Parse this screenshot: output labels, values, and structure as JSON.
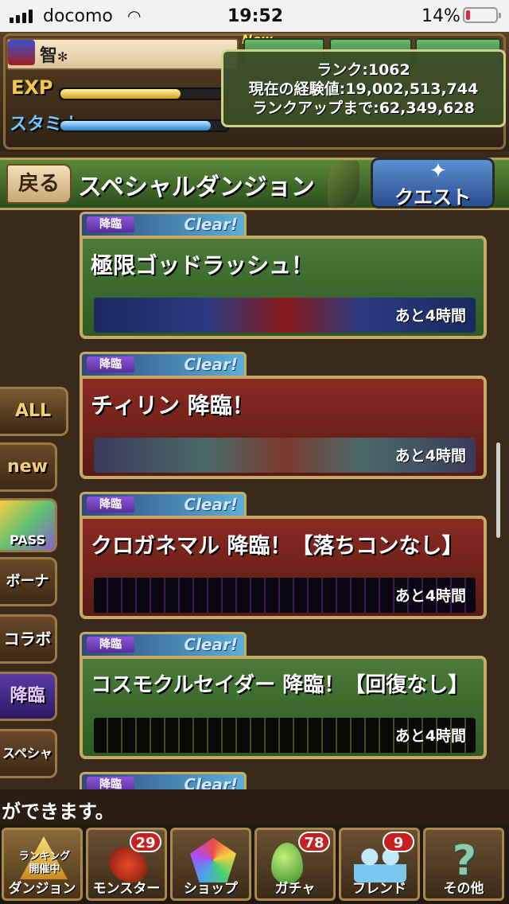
{
  "status_bar": {
    "carrier": "docomo",
    "time": "19:52",
    "battery": "14%",
    "battery_level": 0.14
  },
  "header": {
    "player_name": "智",
    "name_mark": "✻",
    "new_tag": "New",
    "exp_label": "EXP",
    "stamina_label": "スタミナ",
    "exp_fill": 0.72,
    "stamina_fill": 0.9,
    "rank": {
      "line1": "ランク:1062",
      "line2": "現在の経験値:19,002,513,744",
      "line3": "ランクアップまで:62,349,628"
    }
  },
  "titlebar": {
    "back_label": "戻る",
    "title": "スペシャルダンジョン",
    "quest_label": "クエスト"
  },
  "side_tabs": [
    {
      "label": "ALL",
      "color": "#f4d070"
    },
    {
      "label": "new",
      "color": "#f0d080"
    },
    {
      "label": "PASS",
      "color": "#ffffff"
    },
    {
      "label": "ボーナス",
      "color": "#ffffff"
    },
    {
      "label": "コラボ",
      "color": "#ffffff"
    },
    {
      "label": "降臨",
      "color": "#e8c8ff"
    },
    {
      "label": "スペシャル",
      "color": "#ffffff"
    }
  ],
  "dungeons": [
    {
      "badge": "降臨",
      "clear": "Clear!",
      "name": "極限ゴッドラッシュ！",
      "remaining": "あと4時間",
      "theme": "green"
    },
    {
      "badge": "降臨",
      "clear": "Clear!",
      "name": "チィリン 降臨！",
      "remaining": "あと4時間",
      "theme": "red"
    },
    {
      "badge": "降臨",
      "clear": "Clear!",
      "name": "クロガネマル 降臨！【落ちコンなし】",
      "remaining": "あと4時間",
      "theme": "red"
    },
    {
      "badge": "降臨",
      "clear": "Clear!",
      "name": "コスモクルセイダー 降臨！【回復なし】",
      "remaining": "あと4時間",
      "theme": "green"
    }
  ],
  "partial_card": {
    "badge": "降臨",
    "clear": "Clear!"
  },
  "message": "ができます。",
  "nav": [
    {
      "label": "ダンジョン",
      "sub": "ランキング\n開催中",
      "count": ""
    },
    {
      "label": "モンスター",
      "count": "29"
    },
    {
      "label": "ショップ",
      "count": ""
    },
    {
      "label": "ガチャ",
      "count": "78"
    },
    {
      "label": "フレンド",
      "count": "9"
    },
    {
      "label": "その他",
      "count": ""
    }
  ]
}
